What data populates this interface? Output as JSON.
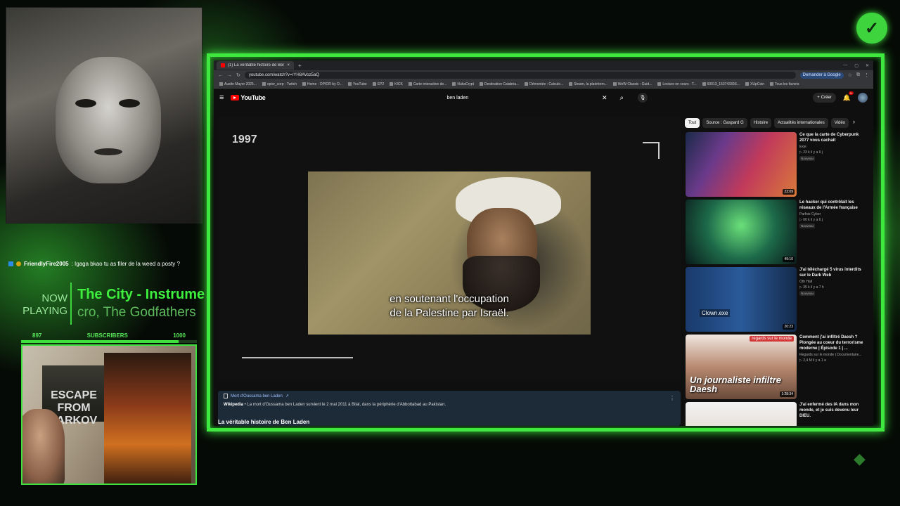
{
  "overlay": {
    "chat": {
      "user": "FriendlyFire2005",
      "message": ": Igaga bkao tu as filer de la weed a posty ?"
    },
    "now_playing": {
      "label_line1": "NOW",
      "label_line2": "PLAYING",
      "title": "The City - Instrume",
      "artist": "cro, The Godfathers"
    },
    "subscribers": {
      "current": "897",
      "label": "SUBSCRIBERS",
      "goal": "1000",
      "progress": 0.897
    },
    "poster_text": "ESCAPE FROM TARKOV",
    "accent_color": "#3ee83e"
  },
  "browser": {
    "tab_title": "(1) La véritable histoire de Ben",
    "url": "youtube.com/watch?v=rYH8AVoz5aQ",
    "ask_google": "Demander à Google",
    "bookmarks": [
      "Austin Mayor 2025...",
      "opior_corp - Twitch",
      "Home - OPIOR by O...",
      "YouTube",
      "EP2",
      "KICK",
      "Carte interactive de...",
      "NukaCrypt",
      "Destination Calabria...",
      "Démontée : Calcule...",
      "Steam, la plateform...",
      "WoW Classic : Guid...",
      "Lecture en cours · T...",
      "60013_15374330S...",
      "XUpCoin",
      "Tous les favoris"
    ]
  },
  "youtube": {
    "logo_text": "YouTube",
    "search_value": "ben laden",
    "create_label": "Créer",
    "notif_count": "9+",
    "player": {
      "year": "1997",
      "subtitle_line1": "en soutenant l'occupation",
      "subtitle_line2": "de la Palestine par Israël.",
      "progress": 0.24
    },
    "info_card": {
      "link": "Mort d'Oussama ben Laden",
      "source": "Wikipedia",
      "text": " • La mort d'Oussama ben Laden survient le 2 mai 2011 à Bilal, dans la périphérie d'Abbottabad au Pakistan."
    },
    "video_title": "La véritable histoire de Ben Laden",
    "chips": [
      "Tout",
      "Source : Gaspard G",
      "Histoire",
      "Actualités internationales",
      "Vidéo"
    ],
    "recommendations": [
      {
        "title": "Ce que la carte de Cyberpunk 2077 vous cachait",
        "channel": "Exie",
        "stats": "▷ 23 k il y a 6 j",
        "badge": "Nouveau",
        "duration": "23:09"
      },
      {
        "title": "Le hacker qui contrôlait les réseaux de l'Armée française",
        "channel": "Parfois Cyber",
        "stats": "▷ 60 k il y a 6 j",
        "badge": "Nouveau",
        "duration": "49:10"
      },
      {
        "title": "J'ai téléchargé 5 virus interdits sur le Dark Web",
        "channel": "Oth Hall",
        "stats": "▷ 35 k il y a 7 h",
        "badge": "Nouveau",
        "duration": "20:23",
        "overlay": "Clown.exe"
      },
      {
        "title": "Comment j'ai infiltré Daesh ? Plongée au coeur du terrorisme moderne | Épisode 1 | ...",
        "channel": "Regards sur le monde | Documentaire...",
        "stats": "▷ 2,4 M il y a 1 a",
        "duration": "1:28:34",
        "overlay": "Un journaliste infiltre Daesh",
        "corner_label": "regards sur le monde"
      },
      {
        "title": "J'ai enfermé des IA dans mon monde, et je suis devenu leur DIEU.",
        "channel": "",
        "stats": ""
      }
    ]
  }
}
